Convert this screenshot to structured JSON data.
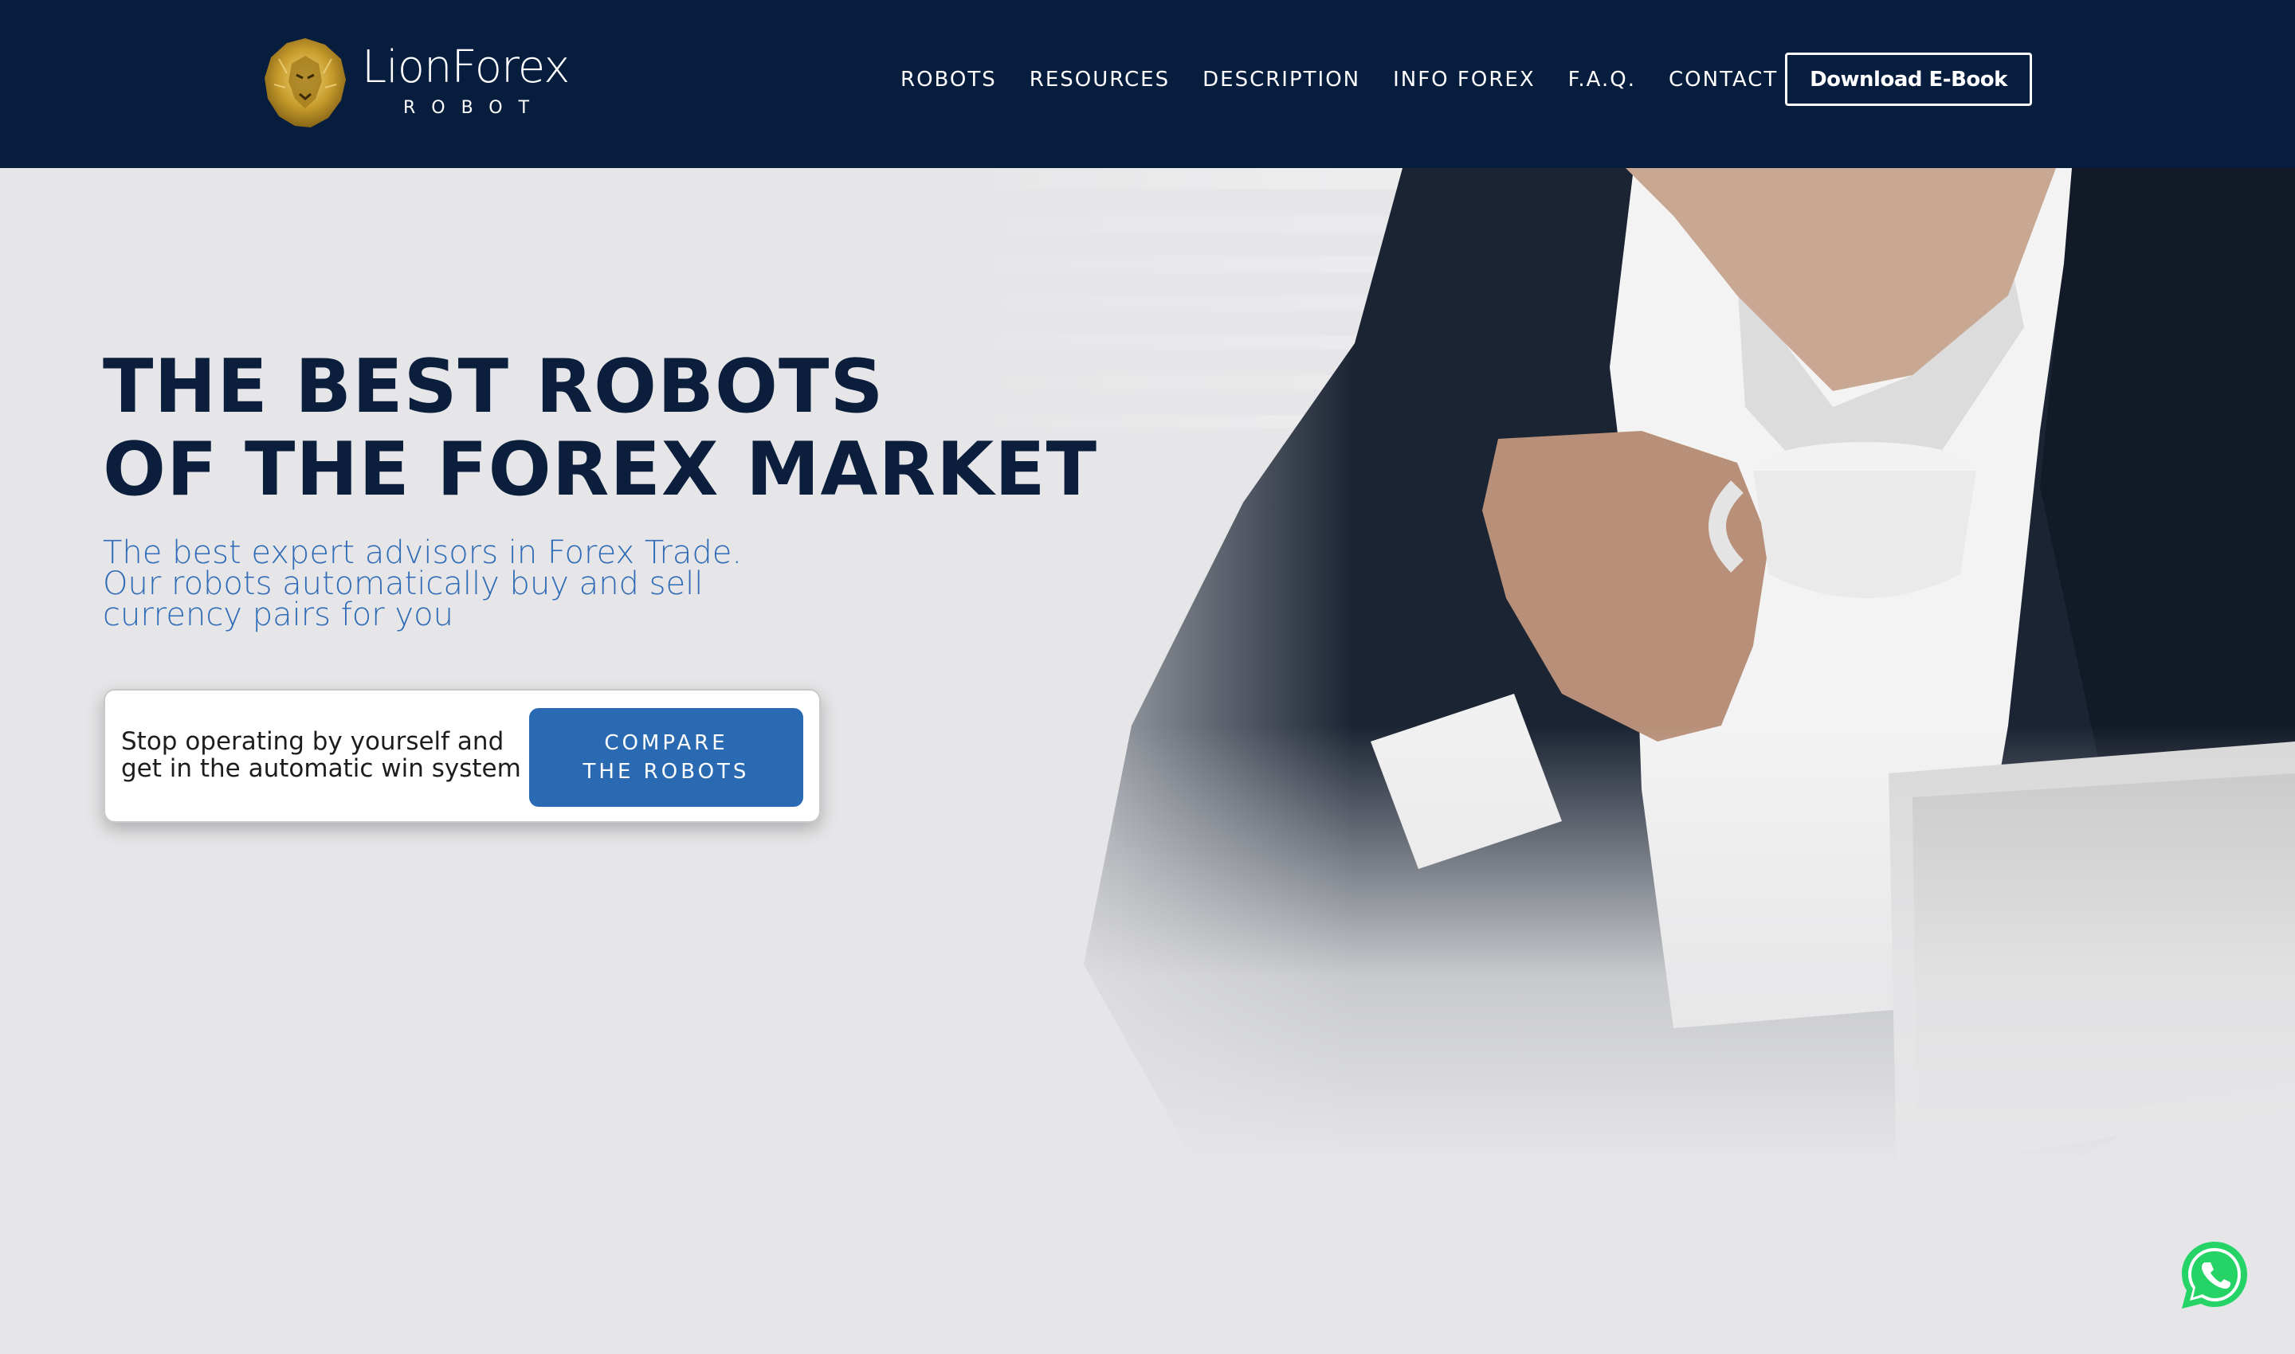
{
  "brand": {
    "name": "LionForex",
    "sub": "ROBOT",
    "logo_icon": "lion-head-icon",
    "accent_gold": "#c9a227"
  },
  "nav": {
    "items": [
      {
        "label": "ROBOTS"
      },
      {
        "label": "RESOURCES"
      },
      {
        "label": "DESCRIPTION"
      },
      {
        "label": "INFO FOREX"
      },
      {
        "label": "F.A.Q."
      },
      {
        "label": "CONTACT"
      }
    ],
    "cta_label": "Download E-Book"
  },
  "hero": {
    "title_line1": "THE BEST ROBOTS",
    "title_line2": "OF THE FOREX MARKET",
    "sub_line1": "The best expert advisors in Forex Trade.",
    "sub_line2": "Our robots automatically buy and sell",
    "sub_line3": "currency pairs for you",
    "card": {
      "text_line1": "Stop operating by yourself and",
      "text_line2": "get in the automatic win system",
      "button_line1": "COMPARE",
      "button_line2": "THE ROBOTS"
    }
  },
  "floating": {
    "whatsapp_icon": "whatsapp-icon"
  },
  "colors": {
    "header_bg": "#061d3e",
    "title": "#0b1f3d",
    "subtitle": "#2f6bb6",
    "button": "#2a6ab3",
    "whatsapp": "#25d366"
  }
}
